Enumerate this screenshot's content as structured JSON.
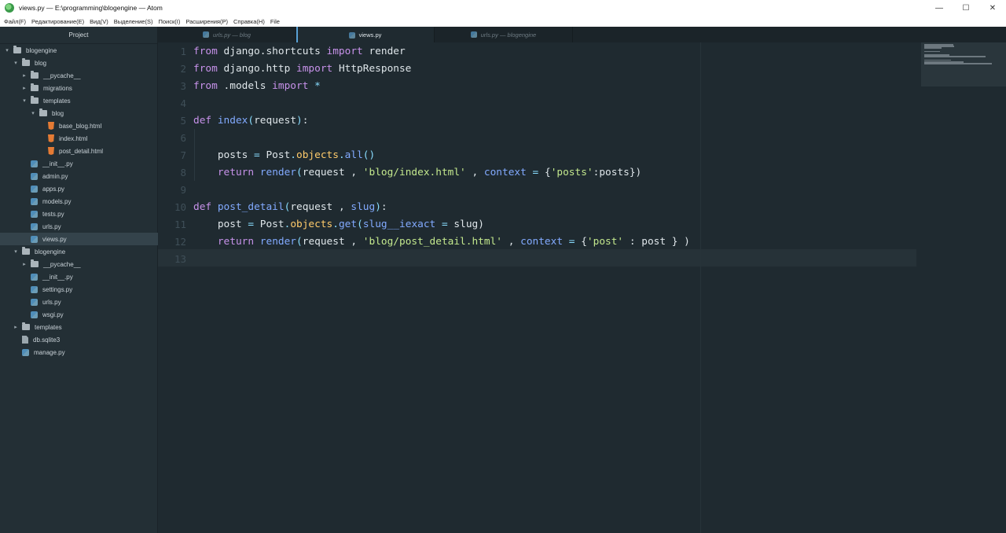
{
  "window": {
    "title": "views.py — E:\\programming\\blogengine — Atom",
    "controls": [
      "—",
      "☐",
      "✕"
    ]
  },
  "menu": [
    "Файл(F)",
    "Редактирование(E)",
    "Вид(V)",
    "Выделение(S)",
    "Поиск(I)",
    "Расширения(P)",
    "Справка(H)",
    "File"
  ],
  "sidebar": {
    "title": "Project",
    "tree": [
      {
        "label": "blogengine",
        "icon": "folder",
        "expanded": true
      },
      {
        "label": "blog",
        "icon": "folder",
        "expanded": true
      },
      {
        "label": "__pycache__",
        "icon": "folder",
        "expanded": false
      },
      {
        "label": "migrations",
        "icon": "folder",
        "expanded": false
      },
      {
        "label": "templates",
        "icon": "folder",
        "expanded": true
      },
      {
        "label": "blog",
        "icon": "folder",
        "expanded": true
      },
      {
        "label": "base_blog.html",
        "icon": "html"
      },
      {
        "label": "index.html",
        "icon": "html"
      },
      {
        "label": "post_detail.html",
        "icon": "html"
      },
      {
        "label": "__init__.py",
        "icon": "python"
      },
      {
        "label": "admin.py",
        "icon": "python"
      },
      {
        "label": "apps.py",
        "icon": "python"
      },
      {
        "label": "models.py",
        "icon": "python"
      },
      {
        "label": "tests.py",
        "icon": "python"
      },
      {
        "label": "urls.py",
        "icon": "python"
      },
      {
        "label": "views.py",
        "icon": "python",
        "selected": true
      },
      {
        "label": "blogengine",
        "icon": "folder",
        "expanded": true
      },
      {
        "label": "__pycache__",
        "icon": "folder",
        "expanded": false
      },
      {
        "label": "__init__.py",
        "icon": "python"
      },
      {
        "label": "settings.py",
        "icon": "python"
      },
      {
        "label": "urls.py",
        "icon": "python"
      },
      {
        "label": "wsgi.py",
        "icon": "python"
      },
      {
        "label": "templates",
        "icon": "folder",
        "expanded": false
      },
      {
        "label": "db.sqlite3",
        "icon": "file"
      },
      {
        "label": "manage.py",
        "icon": "python"
      }
    ]
  },
  "tabs": [
    {
      "label": "urls.py — blog",
      "active": false
    },
    {
      "label": "views.py",
      "active": true
    },
    {
      "label": "urls.py — blogengine",
      "active": false
    }
  ],
  "editor": {
    "line_numbers": [
      "1",
      "2",
      "3",
      "4",
      "5",
      "6",
      "7",
      "8",
      "9",
      "10",
      "11",
      "12",
      "13"
    ],
    "lines": [
      [
        [
          "k",
          "from"
        ],
        [
          "t",
          " django.shortcuts "
        ],
        [
          "k",
          "import"
        ],
        [
          "t",
          " render"
        ]
      ],
      [
        [
          "k",
          "from"
        ],
        [
          "t",
          " django.http "
        ],
        [
          "k",
          "import"
        ],
        [
          "t",
          " HttpResponse"
        ]
      ],
      [
        [
          "k",
          "from"
        ],
        [
          "t",
          " .models "
        ],
        [
          "k",
          "import"
        ],
        [
          "t",
          " "
        ],
        [
          "p",
          "*"
        ]
      ],
      [],
      [
        [
          "k",
          "def"
        ],
        [
          "t",
          " "
        ],
        [
          "f",
          "index"
        ],
        [
          "p",
          "("
        ],
        [
          "t",
          "request"
        ],
        [
          "p",
          ")"
        ],
        [
          "t",
          ":"
        ]
      ],
      [],
      [
        [
          "t",
          "    posts "
        ],
        [
          "p",
          "="
        ],
        [
          "t",
          " Post"
        ],
        [
          "p",
          "."
        ],
        [
          "o",
          "objects"
        ],
        [
          "p",
          "."
        ],
        [
          "f",
          "all"
        ],
        [
          "p",
          "()"
        ]
      ],
      [
        [
          "t",
          "    "
        ],
        [
          "k",
          "return"
        ],
        [
          "t",
          " "
        ],
        [
          "f",
          "render"
        ],
        [
          "p",
          "("
        ],
        [
          "t",
          "request , "
        ],
        [
          "s",
          "'blog/index.html'"
        ],
        [
          "t",
          " , "
        ],
        [
          "f",
          "context"
        ],
        [
          "t",
          " "
        ],
        [
          "p",
          "="
        ],
        [
          "t",
          " {"
        ],
        [
          "s",
          "'posts'"
        ],
        [
          "t",
          ":posts})"
        ]
      ],
      [],
      [
        [
          "k",
          "def"
        ],
        [
          "t",
          " "
        ],
        [
          "f",
          "post_detail"
        ],
        [
          "p",
          "("
        ],
        [
          "t",
          "request , "
        ],
        [
          "f",
          "slug"
        ],
        [
          "p",
          ")"
        ],
        [
          "t",
          ":"
        ]
      ],
      [
        [
          "t",
          "    post "
        ],
        [
          "p",
          "="
        ],
        [
          "t",
          " Post"
        ],
        [
          "p",
          "."
        ],
        [
          "o",
          "objects"
        ],
        [
          "p",
          "."
        ],
        [
          "f",
          "get"
        ],
        [
          "p",
          "("
        ],
        [
          "f",
          "slug__iexact"
        ],
        [
          "t",
          " "
        ],
        [
          "p",
          "="
        ],
        [
          "t",
          " slug)"
        ]
      ],
      [
        [
          "t",
          "    "
        ],
        [
          "k",
          "return"
        ],
        [
          "t",
          " "
        ],
        [
          "f",
          "render"
        ],
        [
          "p",
          "("
        ],
        [
          "t",
          "request , "
        ],
        [
          "s",
          "'blog/post_detail.html'"
        ],
        [
          "t",
          " , "
        ],
        [
          "f",
          "context"
        ],
        [
          "t",
          " "
        ],
        [
          "p",
          "="
        ],
        [
          "t",
          " {"
        ],
        [
          "s",
          "'post'"
        ],
        [
          "t",
          " : post } )"
        ]
      ],
      []
    ]
  },
  "colors": {
    "keyword": "#c792ea",
    "function": "#82aaff",
    "string": "#c3e88d",
    "punctuation": "#89ddff",
    "attribute": "#ffcb6b",
    "text": "#dfe6ea",
    "background": "#1f2a30",
    "sidebar": "#232f35"
  }
}
